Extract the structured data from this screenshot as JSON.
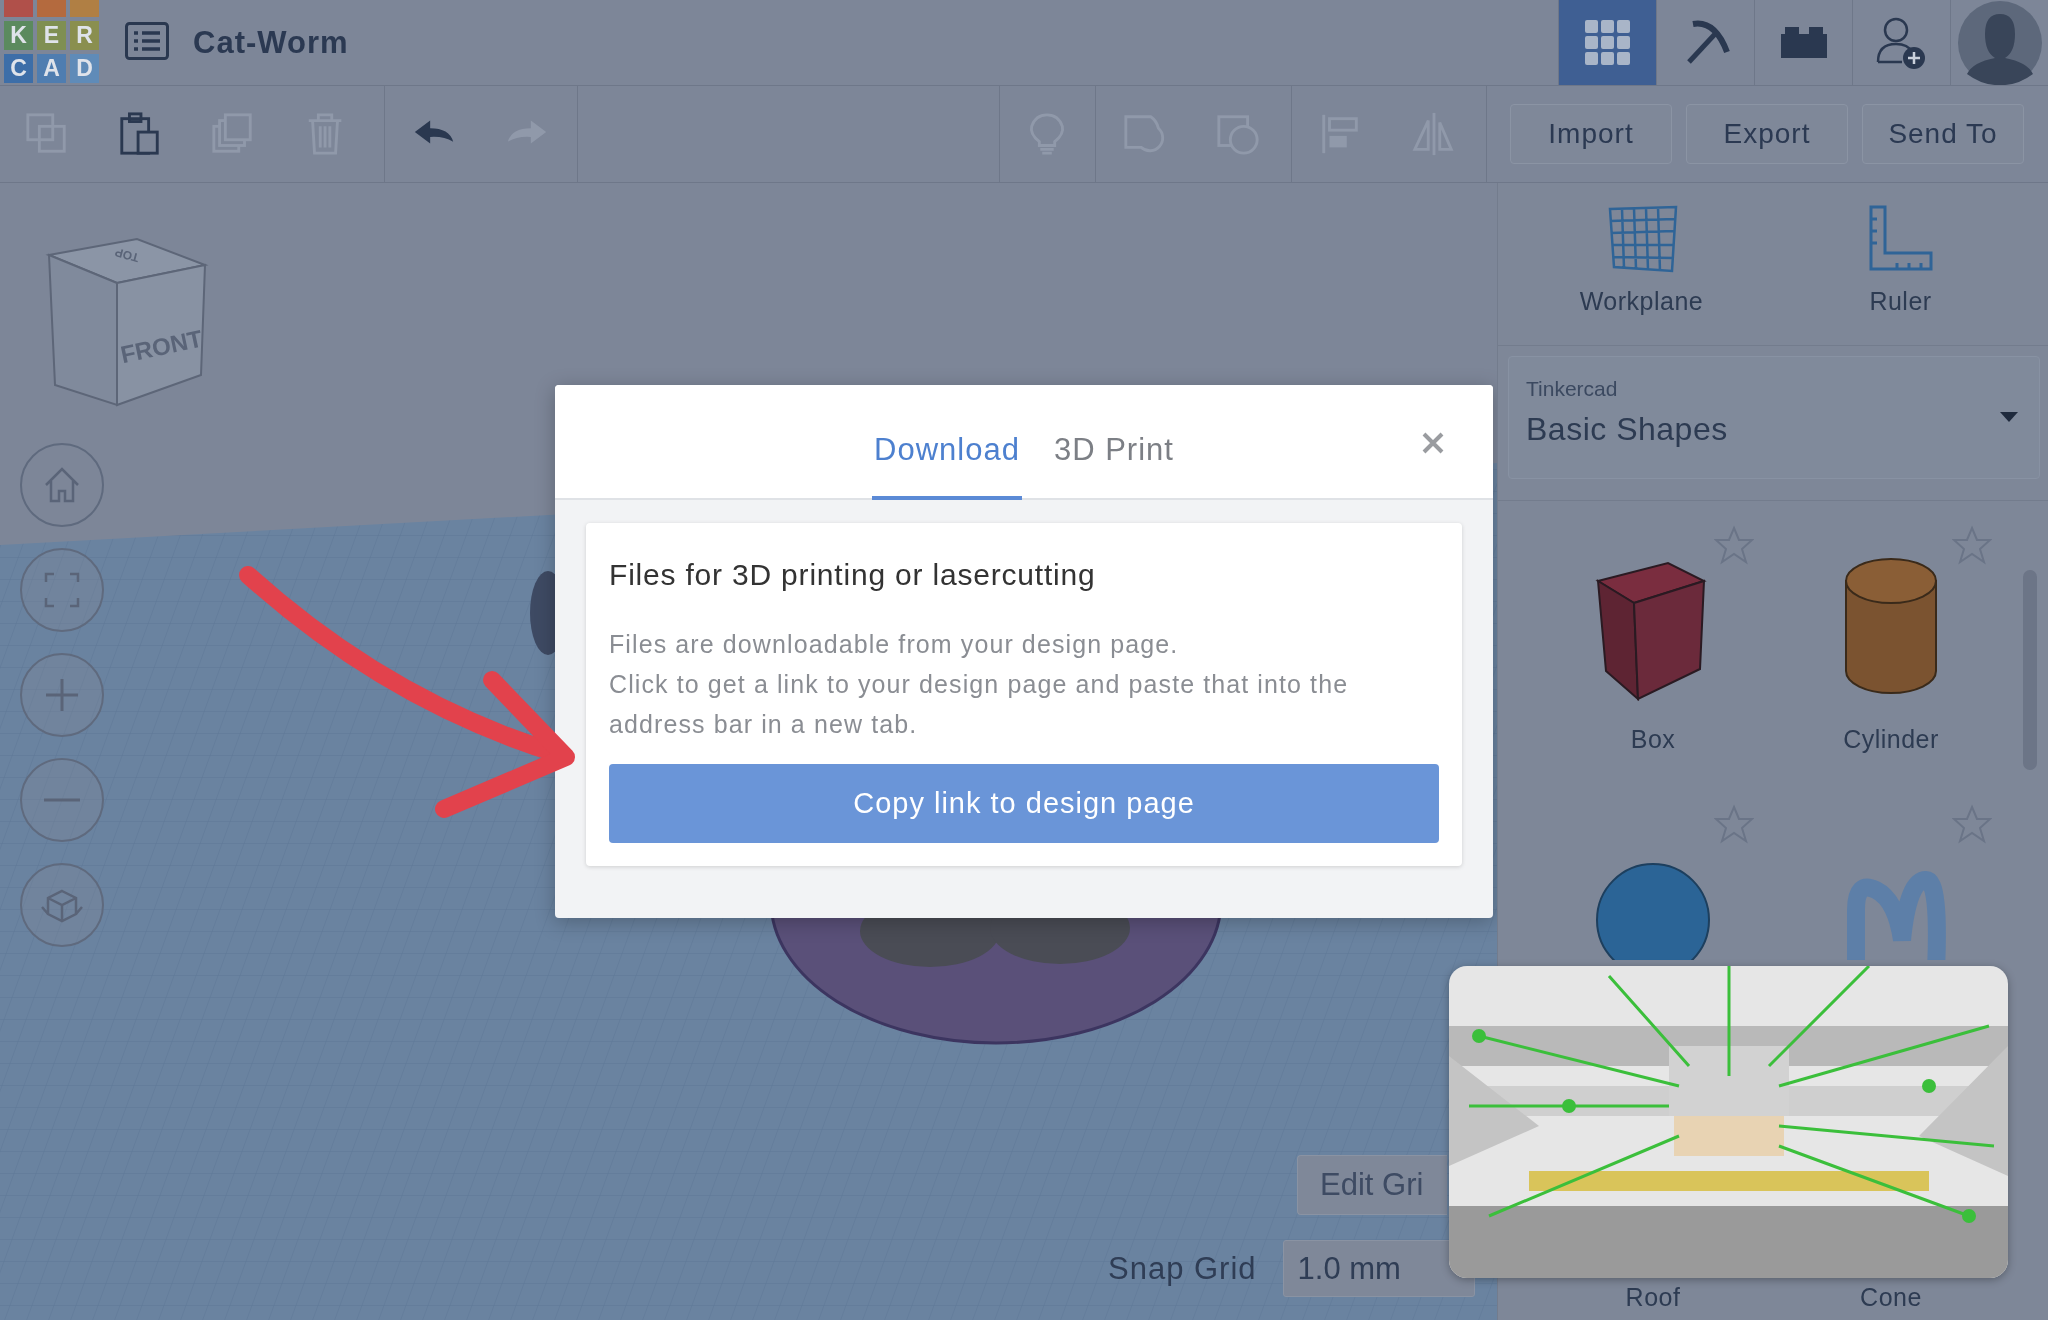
{
  "app": {
    "logo_letters": [
      "K",
      "E",
      "R",
      "C",
      "A",
      "D"
    ],
    "design_name": "Cat-Worm"
  },
  "view_modes": [
    {
      "kind": "grid",
      "selected": true
    },
    {
      "kind": "pickaxe",
      "selected": false
    },
    {
      "kind": "bricks",
      "selected": false
    }
  ],
  "edit_tools": [
    {
      "kind": "copy",
      "disabled": true
    },
    {
      "kind": "paste",
      "disabled": false
    },
    {
      "kind": "duplicate",
      "disabled": true
    },
    {
      "kind": "delete",
      "disabled": true
    }
  ],
  "history": [
    {
      "kind": "undo",
      "disabled": false
    },
    {
      "kind": "redo",
      "disabled": true
    }
  ],
  "shape_tools": [
    {
      "kind": "light",
      "disabled": true
    },
    {
      "kind": "group",
      "disabled": true
    },
    {
      "kind": "ungroup",
      "disabled": true
    },
    {
      "kind": "align",
      "disabled": true
    },
    {
      "kind": "mirror",
      "disabled": true
    }
  ],
  "actions": [
    "Import",
    "Export",
    "Send To"
  ],
  "view_cube": {
    "front": "FRONT",
    "top": "TOP"
  },
  "nav_controls": [
    {
      "kind": "home"
    },
    {
      "kind": "fit"
    },
    {
      "kind": "zoom-in"
    },
    {
      "kind": "zoom-out"
    },
    {
      "kind": "perspective"
    }
  ],
  "grid_controls": {
    "edit": "Edit Gri",
    "snap_label": "Snap Grid",
    "snap_value": "1.0 mm"
  },
  "dialog": {
    "tabs": [
      {
        "label": "Download",
        "selected": true
      },
      {
        "label": "3D Print",
        "selected": false
      }
    ],
    "title": "Files for 3D printing or lasercutting",
    "paragraphs": [
      "Files are downloadable from your design page.",
      "Click to get a link to your design page and paste that into the address bar in a new tab."
    ],
    "button": "Copy link to design page"
  },
  "tools": [
    {
      "kind": "workplane",
      "label": "Workplane"
    },
    {
      "kind": "ruler",
      "label": "Ruler"
    }
  ],
  "library": {
    "source": "Tinkercad",
    "category": "Basic Shapes"
  },
  "shapes": [
    {
      "kind": "box",
      "label": "Box",
      "favorite": false
    },
    {
      "kind": "cylinder",
      "label": "Cylinder",
      "favorite": false
    },
    {
      "kind": "sphere",
      "favorite": false
    },
    {
      "kind": "scribble",
      "favorite": false
    },
    {
      "label": "Roof"
    },
    {
      "label": "Cone"
    }
  ]
}
